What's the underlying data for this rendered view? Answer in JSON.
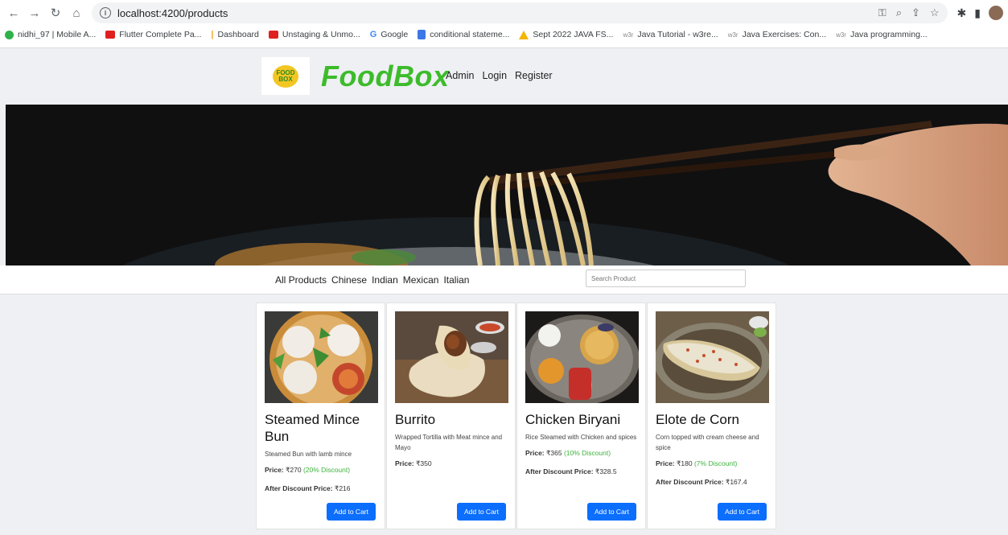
{
  "browser": {
    "url": "localhost:4200/products",
    "bookmarks": [
      {
        "label": "nidhi_97 | Mobile A...",
        "icon": "green-circle-icon"
      },
      {
        "label": "Flutter Complete Pa...",
        "icon": "youtube-icon"
      },
      {
        "label": "Dashboard",
        "icon": "bar-chart-icon"
      },
      {
        "label": "Unstaging & Unmo...",
        "icon": "youtube-icon"
      },
      {
        "label": "Google",
        "icon": "google-icon"
      },
      {
        "label": "conditional stateme...",
        "icon": "docs-icon"
      },
      {
        "label": "Sept 2022 JAVA FS...",
        "icon": "drive-icon"
      },
      {
        "label": "Java Tutorial - w3re...",
        "icon": "w3r-icon"
      },
      {
        "label": "Java Exercises: Con...",
        "icon": "w3r-icon"
      },
      {
        "label": "Java programming...",
        "icon": "w3r-icon"
      }
    ]
  },
  "header": {
    "logo_top": "FOOD",
    "logo_bottom": "BOX",
    "brand": "FoodBox",
    "nav": [
      "Admin",
      "Login",
      "Register"
    ]
  },
  "filters": {
    "categories": [
      "All Products",
      "Chinese",
      "Indian",
      "Mexican",
      "Italian"
    ],
    "search_placeholder": "Search Product"
  },
  "products": [
    {
      "title": "Steamed Mince Bun",
      "description": "Steamed Bun with lamb mince",
      "price_label": "Price:",
      "price": "₹270",
      "discount": "(20% Discount)",
      "after_label": "After Discount Price:",
      "after_price": "₹216",
      "button": "Add to Cart"
    },
    {
      "title": "Burrito",
      "description": "Wrapped Tortilla with Meat mince and Mayo",
      "price_label": "Price:",
      "price": "₹350",
      "discount": "",
      "after_label": "",
      "after_price": "",
      "button": "Add to Cart"
    },
    {
      "title": "Chicken Biryani",
      "description": "Rice Steamed with Chicken and spices",
      "price_label": "Price:",
      "price": "₹365",
      "discount": "(10% Discount)",
      "after_label": "After Discount Price:",
      "after_price": "₹328.5",
      "button": "Add to Cart"
    },
    {
      "title": "Elote de Corn",
      "description": "Corn topped with cream cheese and spice",
      "price_label": "Price:",
      "price": "₹180",
      "discount": "(7% Discount)",
      "after_label": "After Discount Price:",
      "after_price": "₹167.4",
      "button": "Add to Cart"
    }
  ],
  "colors": {
    "brand_green": "#3dbb2b",
    "button_blue": "#0b6efd",
    "discount_green": "#3db33d"
  }
}
